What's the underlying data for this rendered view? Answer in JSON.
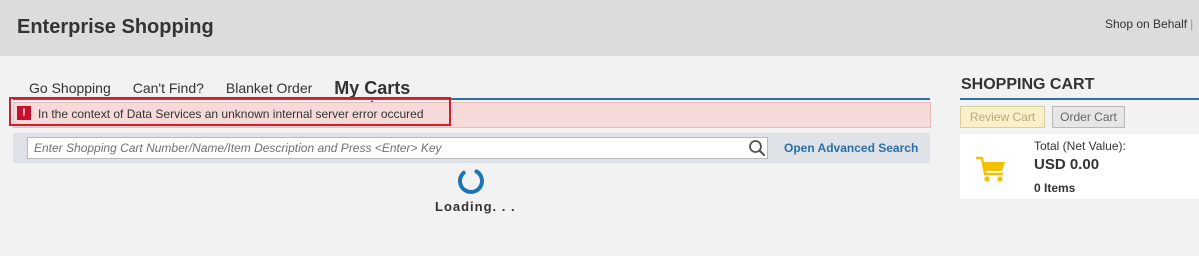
{
  "header": {
    "app_title": "Enterprise Shopping",
    "shop_on_behalf": "Shop on Behalf",
    "separator": "|"
  },
  "nav": {
    "items": [
      {
        "label": "Go Shopping"
      },
      {
        "label": "Can't Find?"
      },
      {
        "label": "Blanket Order"
      },
      {
        "label": "My Carts"
      }
    ],
    "active_tab": "My Carts"
  },
  "error": {
    "icon": "!",
    "message": "In the context of Data Services an unknown internal server error occured"
  },
  "search": {
    "placeholder": "Enter Shopping Cart Number/Name/Item Description and Press <Enter> Key",
    "value": "",
    "advanced_link": "Open Advanced Search"
  },
  "loading": {
    "text": "Loading. . ."
  },
  "cart": {
    "title": "SHOPPING CART",
    "review_button": "Review Cart",
    "order_button": "Order Cart",
    "total_label": "Total (Net Value):",
    "total_value": "USD 0.00",
    "items_count": "0 Items"
  },
  "colors": {
    "accent": "#2a6fa8",
    "error_border": "#d01f2b",
    "error_background": "#f6d9d9",
    "cart_icon": "#f2c200"
  }
}
